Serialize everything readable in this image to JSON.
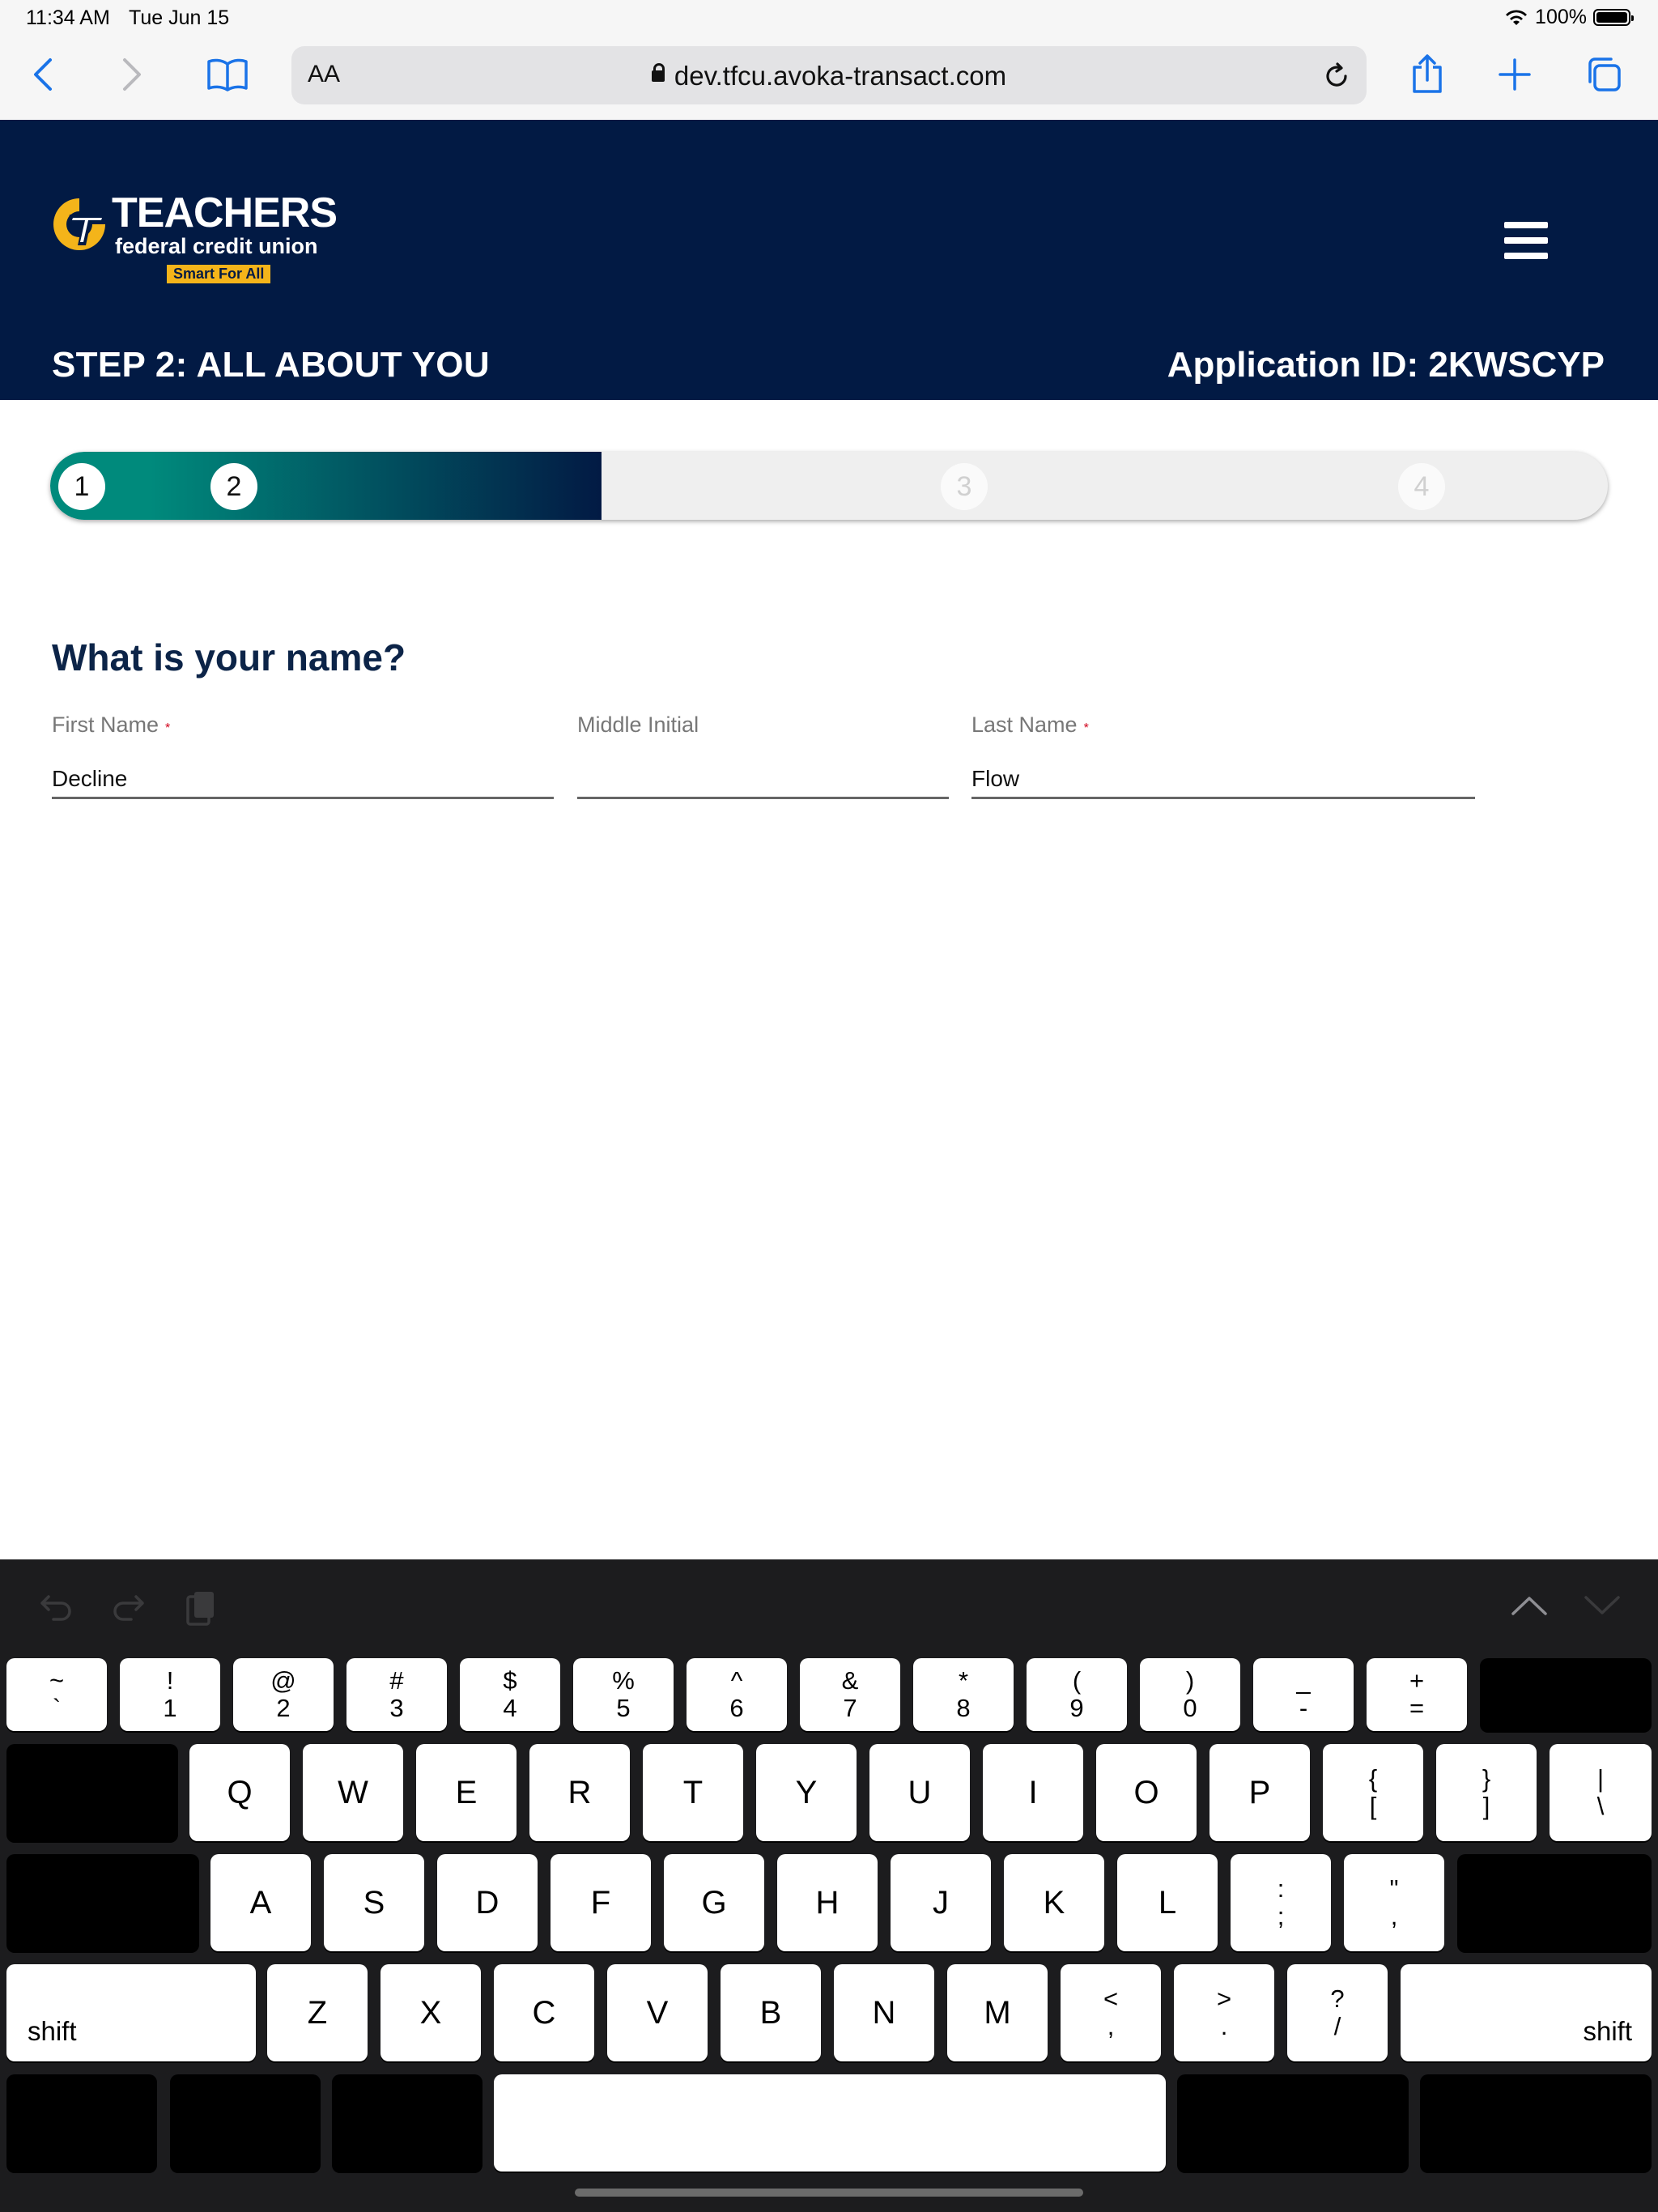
{
  "status_bar": {
    "time": "11:34 AM",
    "date": "Tue Jun 15",
    "battery": "100%"
  },
  "browser": {
    "text_size_label": "AA",
    "url": "dev.tfcu.avoka-transact.com"
  },
  "header": {
    "logo": {
      "name": "TEACHERS",
      "subtitle": "federal credit union",
      "tagline": "Smart For All"
    },
    "step_title": "STEP 2: ALL ABOUT YOU",
    "application_id": "Application ID: 2KWSCYP"
  },
  "progress": {
    "steps": [
      "1",
      "2",
      "3",
      "4"
    ],
    "completed_fraction": 0.354,
    "fill_colors": [
      "#008a7c",
      "#021a44"
    ]
  },
  "form": {
    "question": "What is your name?",
    "first_name": {
      "label": "First Name",
      "required_mark": "*",
      "value": "Decline"
    },
    "middle_initial": {
      "label": "Middle Initial",
      "value": ""
    },
    "last_name": {
      "label": "Last Name",
      "required_mark": "*",
      "value": "Flow"
    }
  },
  "keyboard": {
    "number_row": [
      {
        "top": "~",
        "bot": "`"
      },
      {
        "top": "!",
        "bot": "1"
      },
      {
        "top": "@",
        "bot": "2"
      },
      {
        "top": "#",
        "bot": "3"
      },
      {
        "top": "$",
        "bot": "4"
      },
      {
        "top": "%",
        "bot": "5"
      },
      {
        "top": "^",
        "bot": "6"
      },
      {
        "top": "&",
        "bot": "7"
      },
      {
        "top": "*",
        "bot": "8"
      },
      {
        "top": "(",
        "bot": "9"
      },
      {
        "top": ")",
        "bot": "0"
      },
      {
        "top": "_",
        "bot": "-"
      },
      {
        "top": "+",
        "bot": "="
      }
    ],
    "row_q": [
      "Q",
      "W",
      "E",
      "R",
      "T",
      "Y",
      "U",
      "I",
      "O",
      "P"
    ],
    "row_q_symbols": [
      {
        "top": "{",
        "bot": "["
      },
      {
        "top": "}",
        "bot": "]"
      },
      {
        "top": "|",
        "bot": "\\"
      }
    ],
    "row_a": [
      "A",
      "S",
      "D",
      "F",
      "G",
      "H",
      "J",
      "K",
      "L"
    ],
    "row_a_symbols": [
      {
        "top": ":",
        "bot": ";"
      },
      {
        "top": "\"",
        "bot": ","
      }
    ],
    "row_z": [
      "Z",
      "X",
      "C",
      "V",
      "B",
      "N",
      "M"
    ],
    "row_z_symbols": [
      {
        "top": "<",
        "bot": ","
      },
      {
        "top": ">",
        "bot": "."
      },
      {
        "top": "?",
        "bot": "/"
      }
    ],
    "shift_label": "shift"
  }
}
